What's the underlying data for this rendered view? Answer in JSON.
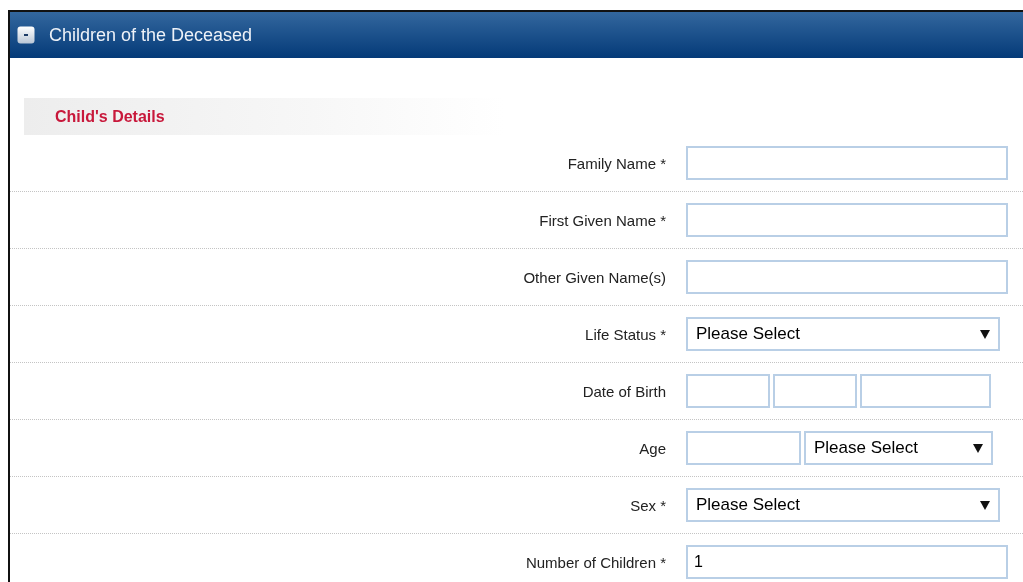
{
  "panel": {
    "title": "Children of the Deceased",
    "expanded": true
  },
  "section": {
    "title": "Child's Details"
  },
  "fields": [
    {
      "label": "Family Name *",
      "kind": "text"
    },
    {
      "label": "First Given Name *",
      "kind": "text"
    },
    {
      "label": "Other Given Name(s)",
      "kind": "text"
    },
    {
      "label": "Life Status *",
      "kind": "select",
      "value": "Please Select"
    },
    {
      "label": "Date of Birth",
      "kind": "date"
    },
    {
      "label": "Age",
      "kind": "age",
      "value": "Please Select"
    },
    {
      "label": "Sex *",
      "kind": "select",
      "value": "Please Select"
    },
    {
      "label": "Number of Children *",
      "kind": "text",
      "value": "1"
    }
  ]
}
